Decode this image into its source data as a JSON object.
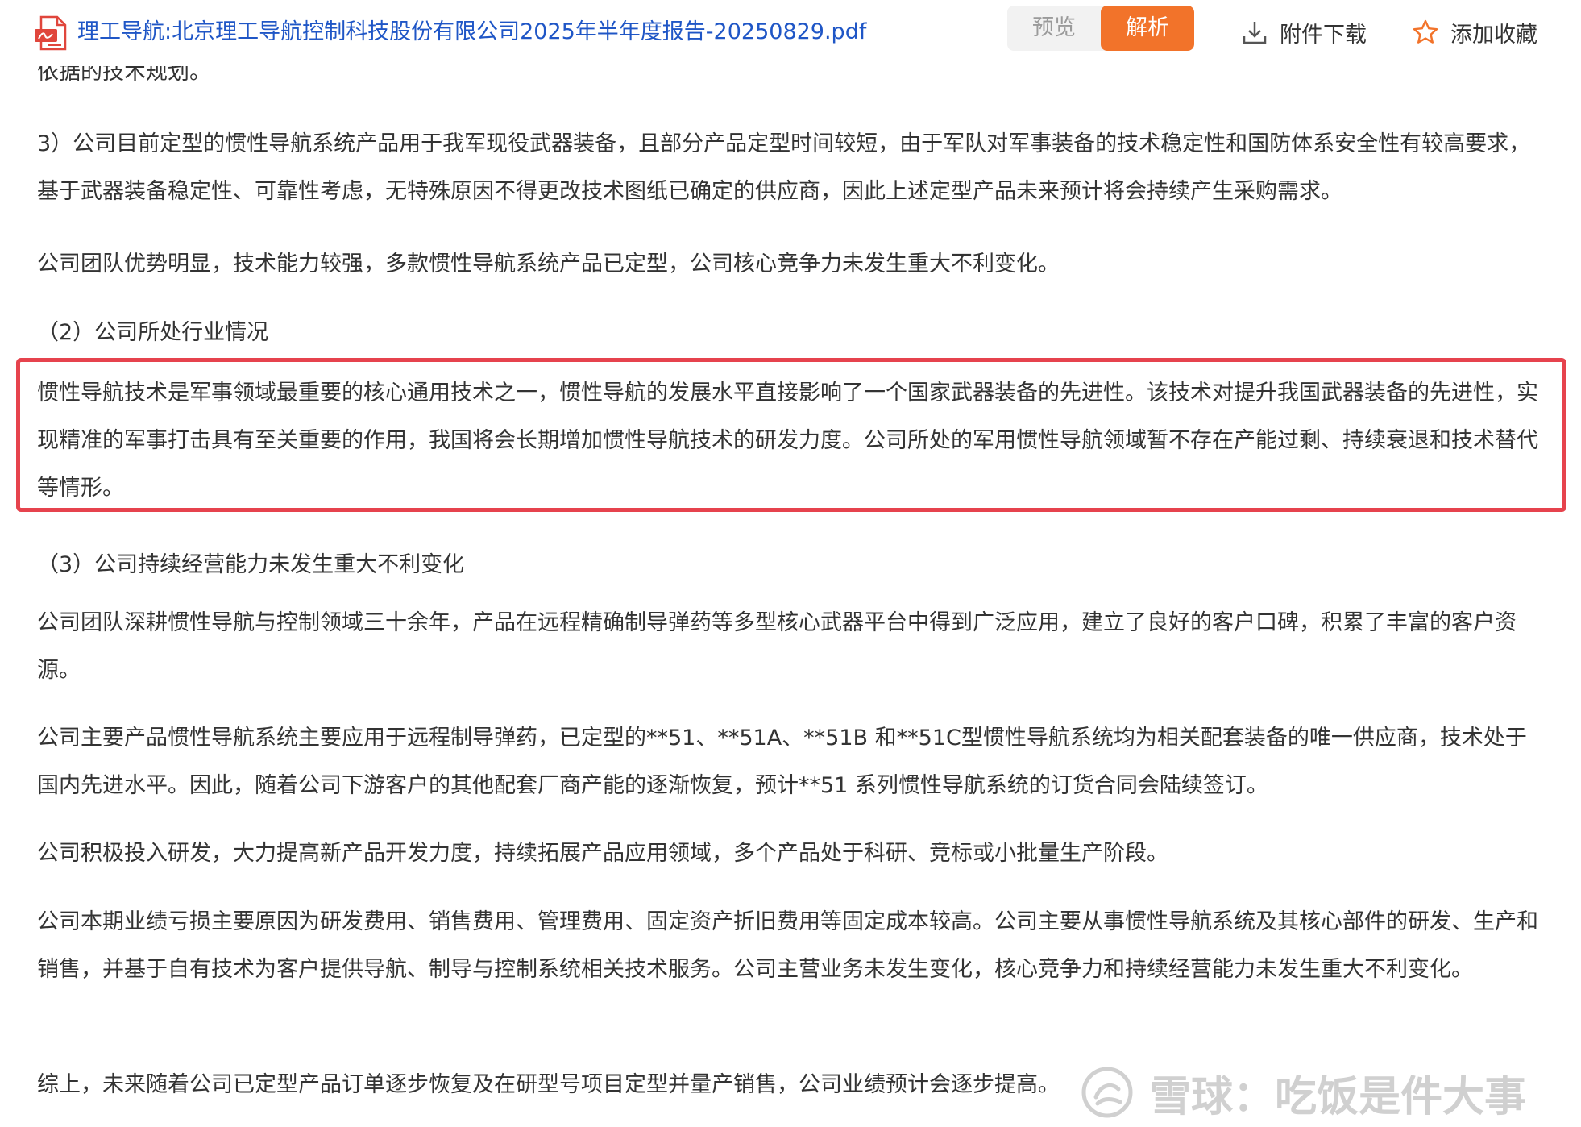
{
  "toolbar": {
    "file_icon": "pdf-file-icon",
    "file_title": "理工导航:北京理工导航控制科技股份有限公司2025年半年度报告-20250829.pdf",
    "preview_label": "预览",
    "parse_label": "解析",
    "download_icon": "download-icon",
    "download_label": "附件下载",
    "favorite_icon": "star-outline-icon",
    "favorite_label": "添加收藏"
  },
  "document": {
    "clipped_top_line": "依据的技术规划。",
    "paragraphs": [
      "3）公司目前定型的惯性导航系统产品用于我军现役武器装备，且部分产品定型时间较短，由于军队对军事装备的技术稳定性和国防体系安全性有较高要求，基于武器装备稳定性、可靠性考虑，无特殊原因不得更改技术图纸已确定的供应商，因此上述定型产品未来预计将会持续产生采购需求。",
      "公司团队优势明显，技术能力较强，多款惯性导航系统产品已定型，公司核心竞争力未发生重大不利变化。",
      "（2）公司所处行业情况",
      "惯性导航技术是军事领域最重要的核心通用技术之一，惯性导航的发展水平直接影响了一个国家武器装备的先进性。该技术对提升我国武器装备的先进性，实现精准的军事打击具有至关重要的作用，我国将会长期增加惯性导航技术的研发力度。公司所处的军用惯性导航领域暂不存在产能过剩、持续衰退和技术替代等情形。",
      "（3）公司持续经营能力未发生重大不利变化",
      "公司团队深耕惯性导航与控制领域三十余年，产品在远程精确制导弹药等多型核心武器平台中得到广泛应用，建立了良好的客户口碑，积累了丰富的客户资源。",
      "公司主要产品惯性导航系统主要应用于远程制导弹药，已定型的**51、**51A、**51B 和**51C型惯性导航系统均为相关配套装备的唯一供应商，技术处于国内先进水平。因此，随着公司下游客户的其他配套厂商产能的逐渐恢复，预计**51 系列惯性导航系统的订货合同会陆续签订。",
      "公司积极投入研发，大力提高新产品开发力度，持续拓展产品应用领域，多个产品处于科研、竞标或小批量生产阶段。",
      "公司本期业绩亏损主要原因为研发费用、销售费用、管理费用、固定资产折旧费用等固定成本较高。公司主要从事惯性导航系统及其核心部件的研发、生产和销售，并基于自有技术为客户提供导航、制导与控制系统相关技术服务。公司主营业务未发生变化，核心竞争力和持续经营能力未发生重大不利变化。",
      "综上，未来随着公司已定型产品订单逐步恢复及在研型号项目定型并量产销售，公司业绩预计会逐步提高。"
    ],
    "highlight_color": "#e6434d"
  },
  "watermark": {
    "logo_icon": "xueqiu-logo-icon",
    "text": "雪球：吃饭是件大事"
  },
  "colors": {
    "title_link": "#1f56c6",
    "accent_orange": "#f2732a",
    "body_text": "#333333"
  }
}
